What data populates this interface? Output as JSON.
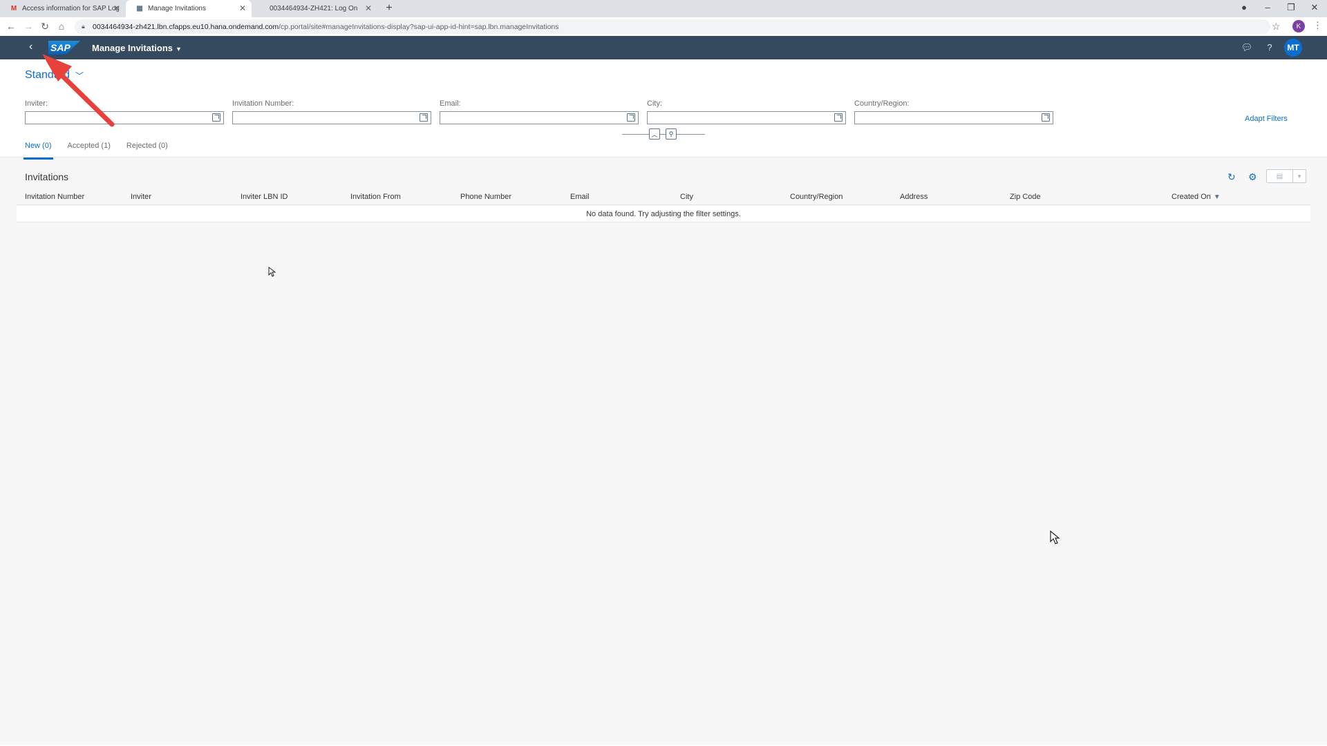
{
  "browser": {
    "tabs": [
      {
        "title": "Access information for SAP Logi",
        "favicon": "gmail-icon",
        "active": false
      },
      {
        "title": "Manage Invitations",
        "favicon": "sap-page-icon",
        "active": true
      },
      {
        "title": "0034464934-ZH421: Log On",
        "favicon": "",
        "active": false
      }
    ],
    "address": {
      "host": "0034464934-zh421.lbn.cfapps.eu10.hana.ondemand.com",
      "path": "/cp.portal/site#manageInvitations-display?sap-ui-app-id-hint=sap.lbn.manageInvitations"
    },
    "profile_initial": "K"
  },
  "shell": {
    "logo": "SAP",
    "app_title": "Manage Invitations",
    "avatar_initials": "MT"
  },
  "filters": {
    "variant": "Standard",
    "fields": [
      {
        "label": "Inviter:",
        "value": ""
      },
      {
        "label": "Invitation Number:",
        "value": ""
      },
      {
        "label": "Email:",
        "value": ""
      },
      {
        "label": "City:",
        "value": ""
      },
      {
        "label": "Country/Region:",
        "value": ""
      }
    ],
    "adapt_filters": "Adapt Filters"
  },
  "tabs": [
    {
      "label": "New (0)",
      "selected": true
    },
    {
      "label": "Accepted (1)",
      "selected": false
    },
    {
      "label": "Rejected (0)",
      "selected": false
    }
  ],
  "table": {
    "title": "Invitations",
    "columns": [
      "Invitation Number",
      "Inviter",
      "Inviter LBN ID",
      "Invitation From",
      "Phone Number",
      "Email",
      "City",
      "Country/Region",
      "Address",
      "Zip Code",
      "Created On"
    ],
    "sorted_column": "Created On",
    "no_data": "No data found. Try adjusting the filter settings."
  },
  "colors": {
    "shell": "#354a5f",
    "accent": "#0a6ed1",
    "annotation_arrow": "#e8413b"
  }
}
